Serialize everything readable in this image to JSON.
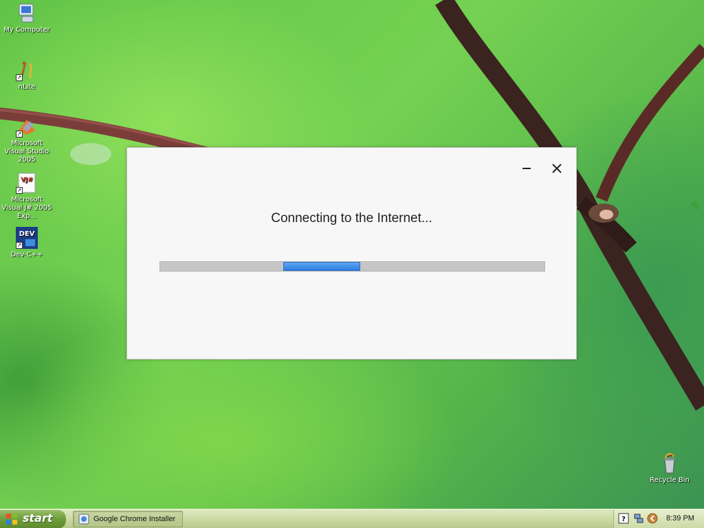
{
  "desktop": {
    "icons": [
      {
        "label": "My Computer",
        "icon": "my-computer-icon"
      },
      {
        "label": "nLite",
        "icon": "nlite-icon"
      },
      {
        "label": "Microsoft Visual Studio 2005",
        "icon": "visual-studio-icon"
      },
      {
        "label": "Microsoft Visual J# 2005 Exp...",
        "icon": "visual-j-sharp-icon"
      },
      {
        "label": "Dev-C++",
        "icon": "dev-cpp-icon"
      },
      {
        "label": "Recycle Bin",
        "icon": "recycle-bin-icon"
      }
    ],
    "dev_icon_text": "DEV",
    "vj_icon_text": "VJ#"
  },
  "dialog": {
    "status_text": "Connecting to the Internet...",
    "progress": {
      "start_fraction": 0.32,
      "end_fraction": 0.52
    },
    "minimize_icon": "minimize-icon",
    "close_icon": "close-icon"
  },
  "taskbar": {
    "start_label": "start",
    "tasks": [
      {
        "label": "Google Chrome Installer",
        "icon": "chrome-installer-icon"
      }
    ],
    "tray": {
      "clock": "8:39 PM",
      "icons": [
        "help-icon",
        "network-icon",
        "chevron-left-icon"
      ]
    }
  },
  "colors": {
    "progress_fill": "#2f7fe0",
    "progress_track": "#c6c6c6",
    "dialog_background": "#f7f7f7"
  }
}
